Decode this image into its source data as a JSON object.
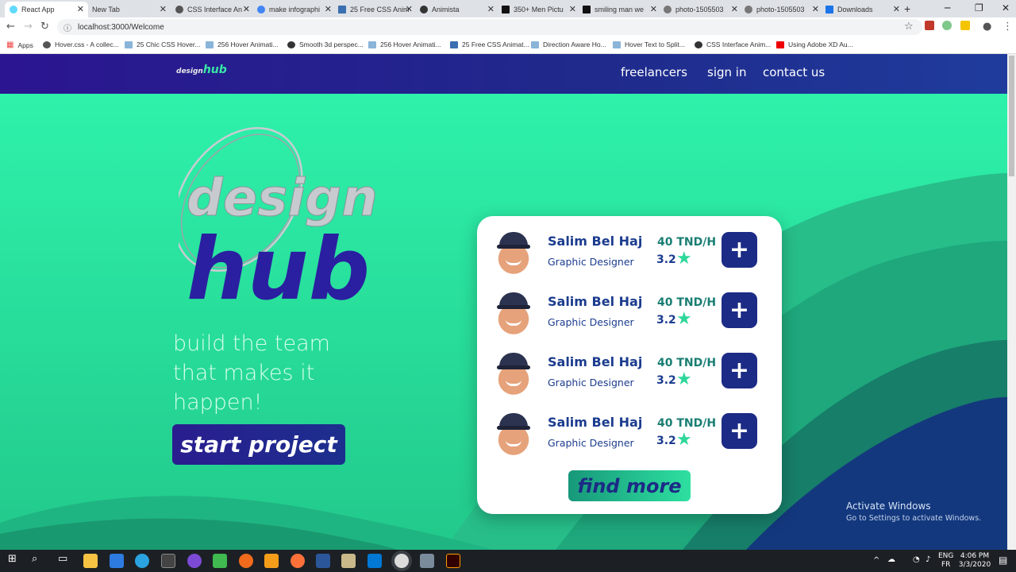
{
  "browser": {
    "tabs": [
      {
        "label": "React App",
        "active": true
      },
      {
        "label": "New Tab"
      },
      {
        "label": "CSS Interface An"
      },
      {
        "label": "make infographi"
      },
      {
        "label": "25 Free CSS Anim"
      },
      {
        "label": "Animista"
      },
      {
        "label": "350+ Men Pictu"
      },
      {
        "label": "smiling man we"
      },
      {
        "label": "photo-1505503"
      },
      {
        "label": "photo-1505503"
      },
      {
        "label": "Downloads"
      }
    ],
    "url": "localhost:3000/Welcome",
    "bookmarks": [
      "Apps",
      "Hover.css - A collec...",
      "25 Chic CSS Hover...",
      "256 Hover Animati...",
      "Smooth 3d perspec...",
      "256 Hover Animati...",
      "25 Free CSS Animat...",
      "Direction Aware Ho...",
      "Hover Text to Split...",
      "CSS Interface Anim...",
      "Using Adobe XD Au..."
    ]
  },
  "header": {
    "logo_design": "design",
    "logo_hub": "hub",
    "nav": [
      "freelancers",
      "sign in",
      "contact us"
    ]
  },
  "hero": {
    "logo_design": "design",
    "logo_hub": "hub",
    "tagline": [
      "build the team",
      "that makes it",
      "happen!"
    ],
    "cta": "start project"
  },
  "freelancers": [
    {
      "name": "Salim Bel Haj",
      "role": "Graphic Designer",
      "rate": "40 TND/H",
      "score": "3.2"
    },
    {
      "name": "Salim Bel Haj",
      "role": "Graphic Designer",
      "rate": "40 TND/H",
      "score": "3.2"
    },
    {
      "name": "Salim Bel Haj",
      "role": "Graphic Designer",
      "rate": "40 TND/H",
      "score": "3.2"
    },
    {
      "name": "Salim Bel Haj",
      "role": "Graphic Designer",
      "rate": "40 TND/H",
      "score": "3.2"
    }
  ],
  "card": {
    "find_more": "find more",
    "add_symbol": "+",
    "star": "★"
  },
  "watermark": {
    "line1": "Activate Windows",
    "line2": "Go to Settings to activate Windows."
  },
  "taskbar": {
    "lang1": "ENG",
    "lang2": "FR",
    "time": "4:06 PM",
    "date": "3/3/2020"
  },
  "colors": {
    "header": "#2b1590",
    "page": "#2de09c",
    "accent_blue": "#1c2b85",
    "accent_green": "#2ed79a"
  }
}
